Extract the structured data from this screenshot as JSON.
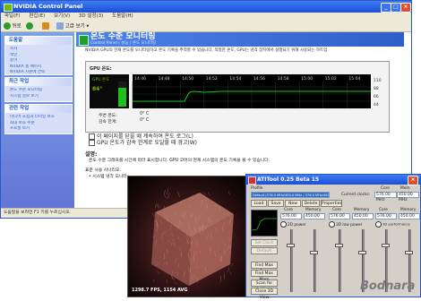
{
  "window": {
    "title": "NVIDIA Control Panel"
  },
  "menu": [
    "파일(F)",
    "편집(E)",
    "보기(V)",
    "3D 설정(3)",
    "도움말(H)"
  ],
  "toolbar": {
    "back": "뒤로",
    "forward": "",
    "home": "",
    "view": "고급 보기"
  },
  "sidebar": {
    "panels": [
      {
        "title": "도움말",
        "items": [
          "목차",
          "색인",
          "용어",
          "NVIDIA 홈 페이지",
          "NVIDIA 지원에 연락"
        ]
      },
      {
        "title": "최근 작업",
        "items": [
          "온도 수준 모니터링",
          "시스템 정보 보기"
        ]
      },
      {
        "title": "관련 작업",
        "items": [
          "미디어 초점과 터미널 보호",
          "최대 보호 수준",
          "프로필 보기"
        ]
      }
    ]
  },
  "content": {
    "title": "온도 수준 모니터링",
    "breadcrumb": "Control Panel  |  성능  |  온도 모니터링",
    "description": "NVIDIA GPU의 현재 온도를 모니터링하고 온도 기록을 추적할 수 있습니다. 적절한 온도, GPU는 냉각 장치에서 실행되기 위해 사용되는 하트업",
    "gpu_label": "GPU 온도:",
    "gpu_name": "GPU 온도",
    "current_temp": "84°",
    "chart_times": [
      "14:46",
      "14:48",
      "14:50",
      "14:52",
      "14:54",
      "14:56",
      "14:58",
      "15:00",
      "15:02",
      "15:04"
    ],
    "chart_scale": [
      "110",
      "88",
      "66",
      "44"
    ],
    "threshold_label": "주변 온도:",
    "threshold_val": "0° C",
    "slowdown_label": "감속 한계:",
    "slowdown_val": "0° C",
    "checkbox1": "이 페이지를 닫을 때 계속하여 온도 로그(L)",
    "checkbox2": "GPU 온도가 감속 한계로 도달할 때 경고(W)",
    "section_label": "설명:",
    "section_text": "온도 수준 그래프를 시간에 따라 표시합니다. GPU 코어의 현재 시스템의 온도 기록을 볼 수 있습니다.",
    "typical_label": "표준 사용 시나리오:",
    "typical_item": "• 시스템 냉각 모니터"
  },
  "status": {
    "text": "도움말을 보려면 F1 키를 누르십시오."
  },
  "render": {
    "fps": "1298.7 FPS, 1154 AVG"
  },
  "ati": {
    "title": "ATITool 0.25 Beta 15",
    "profile_label": "Profile",
    "profile_value": "Default (576.0 MHz/450.0 MHz / 576.0 MHz/450.0 MHz)",
    "core_header": "Core",
    "mem_header": "Mem",
    "current_label": "Current clocks:",
    "current_core": "576.00 MHz",
    "current_mem": "450.00 MHz",
    "buttons": [
      "Load",
      "Save",
      "New",
      "Delete",
      "Properties"
    ],
    "left_buttons": [
      "Set Clock",
      "Default",
      "Find Max Core",
      "Find Max Mem",
      "Scan for Artifacts",
      "Close 3D View"
    ],
    "columns": [
      {
        "core_label": "Core",
        "mem_label": "Memory",
        "core": "576.00",
        "mem": "450.00",
        "radio": "2D power"
      },
      {
        "core_label": "Core",
        "mem_label": "Memory",
        "core": "576.00",
        "mem": "450.00",
        "radio": "3D low power"
      },
      {
        "core_label": "Core",
        "mem_label": "Memory",
        "core": "576.00",
        "mem": "450.00",
        "radio": "3D performance"
      }
    ]
  },
  "watermark": "Bodnara"
}
